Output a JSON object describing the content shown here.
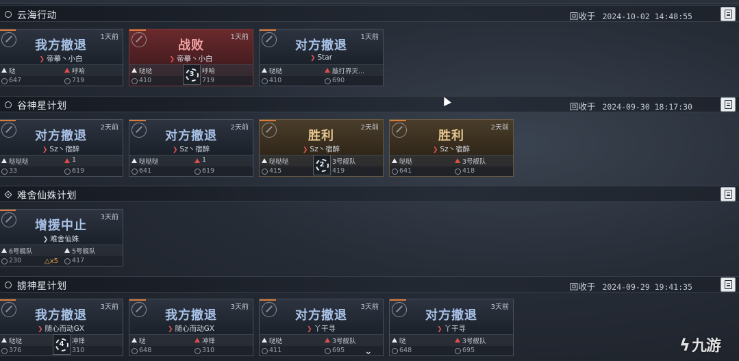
{
  "recycle_label": "回收于",
  "sections": [
    {
      "title": "云海行动",
      "timestamp": "2024-10-02 14:48:55",
      "cards": [
        {
          "result": "我方撤退",
          "ago": "1天前",
          "cmd": "帝摹丶小白",
          "left_name": "哒",
          "right_name": "呼哈",
          "left_num": "647",
          "right_num": "719",
          "turn": ""
        },
        {
          "result": "战败",
          "ago": "1天前",
          "cmd": "帝摹丶小白",
          "left_name": "哒哒",
          "right_name": "呼哈",
          "left_num": "410",
          "right_num": "719",
          "turn": "3"
        },
        {
          "result": "对方撤退",
          "ago": "1天前",
          "cmd": "Star",
          "left_name": "哒哒",
          "right_name": "敲打界灭...",
          "left_num": "410",
          "right_num": "690",
          "turn": ""
        }
      ]
    },
    {
      "title": "谷神星计划",
      "timestamp": "2024-09-30 18:17:30",
      "cards": [
        {
          "result": "对方撤退",
          "ago": "2天前",
          "cmd": "Sz丶宿醉",
          "left_name": "哒哒哒",
          "right_name": "1",
          "left_num": "33",
          "right_num": "619",
          "turn": ""
        },
        {
          "result": "对方撤退",
          "ago": "2天前",
          "cmd": "Sz丶宿醉",
          "left_name": "哒哒哒",
          "right_name": "1",
          "left_num": "641",
          "right_num": "619",
          "turn": ""
        },
        {
          "result": "胜利",
          "ago": "2天前",
          "cmd": "Sz丶宿醉",
          "left_name": "哒哒哒",
          "right_name": "3号舰队",
          "left_num": "415",
          "right_num": "419",
          "turn": "2"
        },
        {
          "result": "胜利",
          "ago": "2天前",
          "cmd": "Sz丶宿醉",
          "left_name": "哒哒",
          "right_name": "3号舰队",
          "left_num": "641",
          "right_num": "418",
          "turn": ""
        }
      ]
    },
    {
      "title": "难舍仙姝计划",
      "timestamp": "",
      "cards": [
        {
          "result": "增援中止",
          "ago": "3天前",
          "cmd": "难舍仙姝",
          "left_name": "6号舰队",
          "right_name": "5号舰队",
          "left_num": "230",
          "right_num": "417",
          "warn": "x5",
          "turn": ""
        }
      ]
    },
    {
      "title": "掳神星计划",
      "timestamp": "2024-09-29 19:41:35",
      "cards": [
        {
          "result": "我方撤退",
          "ago": "3天前",
          "cmd": "随心而动GX",
          "left_name": "哒哒",
          "right_name": "冲锋",
          "left_num": "376",
          "right_num": "310",
          "turn": "4"
        },
        {
          "result": "我方撤退",
          "ago": "3天前",
          "cmd": "随心而动GX",
          "left_name": "哒",
          "right_name": "冲锋",
          "left_num": "648",
          "right_num": "310",
          "turn": ""
        },
        {
          "result": "对方撤退",
          "ago": "3天前",
          "cmd": "丫干寻",
          "left_name": "哒哒",
          "right_name": "3号舰队",
          "left_num": "411",
          "right_num": "695",
          "turn": ""
        },
        {
          "result": "对方撤退",
          "ago": "3天前",
          "cmd": "丫干寻",
          "left_name": "哒",
          "right_name": "3号舰队",
          "left_num": "648",
          "right_num": "695",
          "turn": ""
        }
      ]
    }
  ],
  "watermark": "九游",
  "icons": {
    "section_bullet": "circle-bullet-icon",
    "section_bullet_active": "diamond-bullet-icon",
    "report": "report-document-icon",
    "scroll": "chevron-down-icon"
  },
  "colors": {
    "win": "#e8c68f",
    "defeat": "#f3a3a3",
    "retreat": "#a9c2e8",
    "enemy": "#e04d4d"
  }
}
